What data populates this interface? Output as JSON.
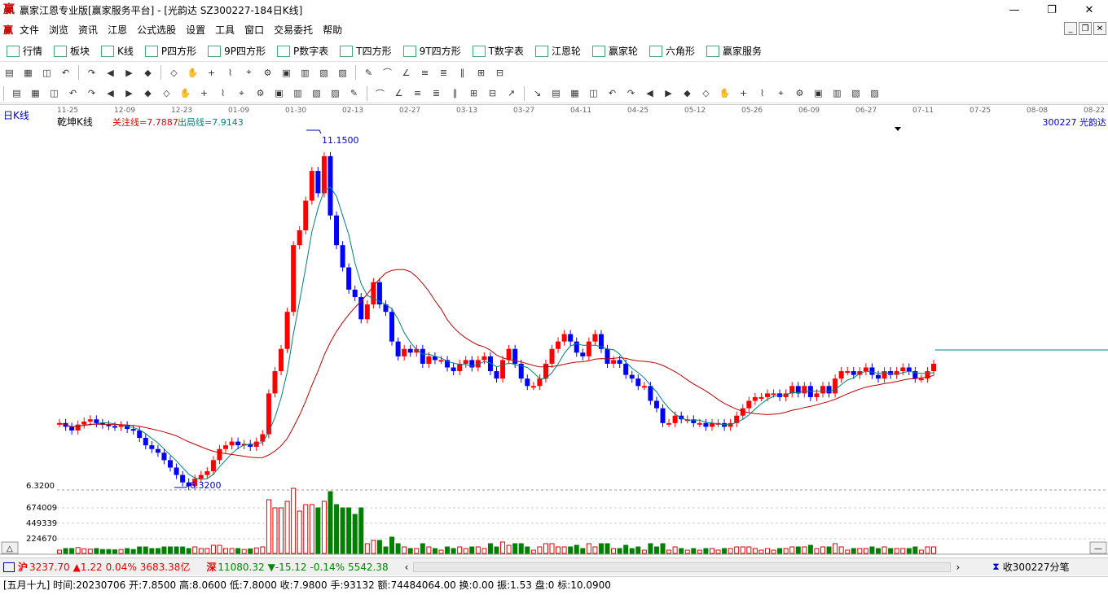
{
  "window": {
    "title": "赢家江恩专业版[赢家服务平台] - [光韵达  SZ300227-184日K线]",
    "min": "—",
    "max": "❐",
    "close": "✕"
  },
  "menu": [
    "文件",
    "浏览",
    "资讯",
    "江恩",
    "公式选股",
    "设置",
    "工具",
    "窗口",
    "交易委托",
    "帮助"
  ],
  "toolbar1": [
    {
      "icon": "market-icon",
      "label": "行情"
    },
    {
      "icon": "sector-icon",
      "label": "板块"
    },
    {
      "icon": "kline-icon",
      "label": "K线"
    },
    {
      "icon": "p-square-icon",
      "label": "P四方形"
    },
    {
      "icon": "9p-square-icon",
      "label": "9P四方形"
    },
    {
      "icon": "p-number-icon",
      "label": "P数字表"
    },
    {
      "icon": "t-square-icon",
      "label": "T四方形"
    },
    {
      "icon": "9t-square-icon",
      "label": "9T四方形"
    },
    {
      "icon": "t-number-icon",
      "label": "T数字表"
    },
    {
      "icon": "gann-wheel-icon",
      "label": "江恩轮"
    },
    {
      "icon": "winner-wheel-icon",
      "label": "赢家轮"
    },
    {
      "icon": "hexagon-icon",
      "label": "六角形"
    },
    {
      "icon": "winner-service-icon",
      "label": "赢家服务"
    }
  ],
  "chart": {
    "period_label": "日K线",
    "indicator_label": "乾坤K线",
    "watch_line": "关注线=7.7887",
    "exit_line": "出局线=7.9143",
    "stock_label": "300227  光韵达",
    "high_label": "11.1500",
    "low_label": "6.3200",
    "price_axis_low": "6.3200",
    "vol_ticks": [
      "674009",
      "449339",
      "224670"
    ],
    "dates": [
      "11-25",
      "12-09",
      "12-23",
      "01-09",
      "01-30",
      "02-13",
      "02-27",
      "03-13",
      "03-27",
      "04-11",
      "04-25",
      "05-12",
      "05-26",
      "06-09",
      "06-27",
      "07-11",
      "07-25",
      "08-08",
      "08-22"
    ]
  },
  "status": {
    "sh_index": "3237.70",
    "sh_change": "▲1.22",
    "sh_pct": "0.04%",
    "sh_amount": "3683.38亿",
    "sz_index": "11080.32",
    "sz_change": "▼-15.12",
    "sz_pct": "-0.14%",
    "sz_amount": "5542.38",
    "tick_label": "收300227分笔"
  },
  "info": "[五月十九] 时间:20230706 开:7.8500 高:8.0600 低:7.8000 收:7.9800 手:93132 额:74484064.00 换:0.00 振:1.53 盘:0 标:10.0900",
  "colors": {
    "up": "#ff0000",
    "down": "#0000ff",
    "purple": "#800080",
    "ma_short": "#008080",
    "ma_long": "#c00000",
    "vol_up": "#e00000",
    "vol_down": "#008000"
  }
}
